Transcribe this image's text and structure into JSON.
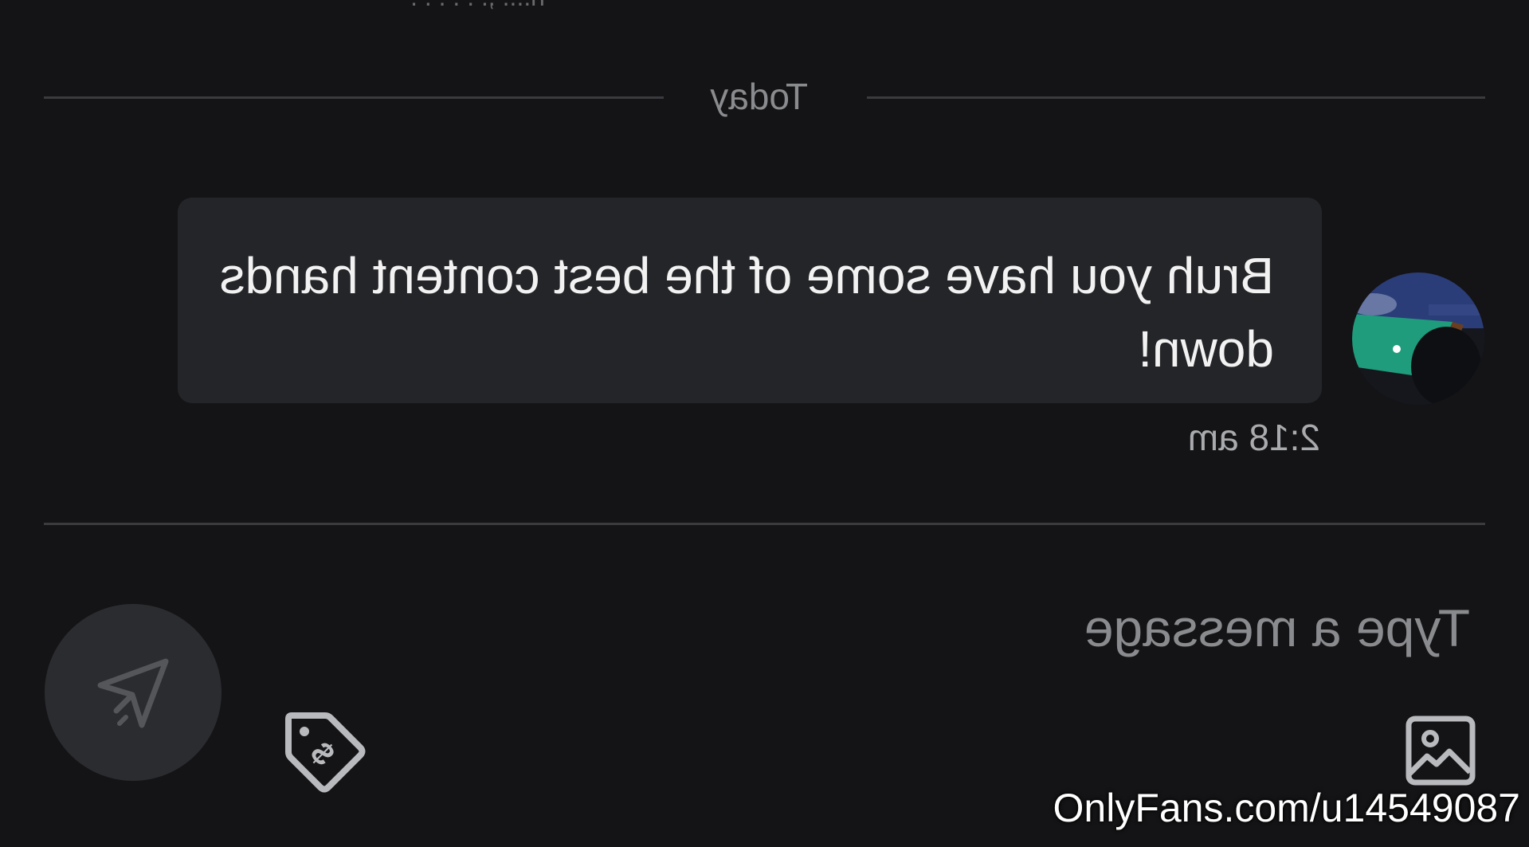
{
  "chat": {
    "top_cut_text": "n.... ,. . . .  . .",
    "date_divider": "Today",
    "messages": [
      {
        "text": "Bruh you have some of the best content hands down!",
        "time": "2:18 am",
        "avatar_icon": "user-avatar-pool-table"
      }
    ]
  },
  "composer": {
    "placeholder": "Type a message",
    "media_icon": "image-icon",
    "price_icon": "price-tag-icon",
    "send_icon": "send-icon"
  },
  "watermark": {
    "text": "OnlyFans.com/u145490​87"
  },
  "colors": {
    "background": "#141416",
    "bubble": "#242528",
    "divider": "#3a3b3e",
    "muted_text": "#8a8b8e",
    "icon": "#b9babd"
  }
}
